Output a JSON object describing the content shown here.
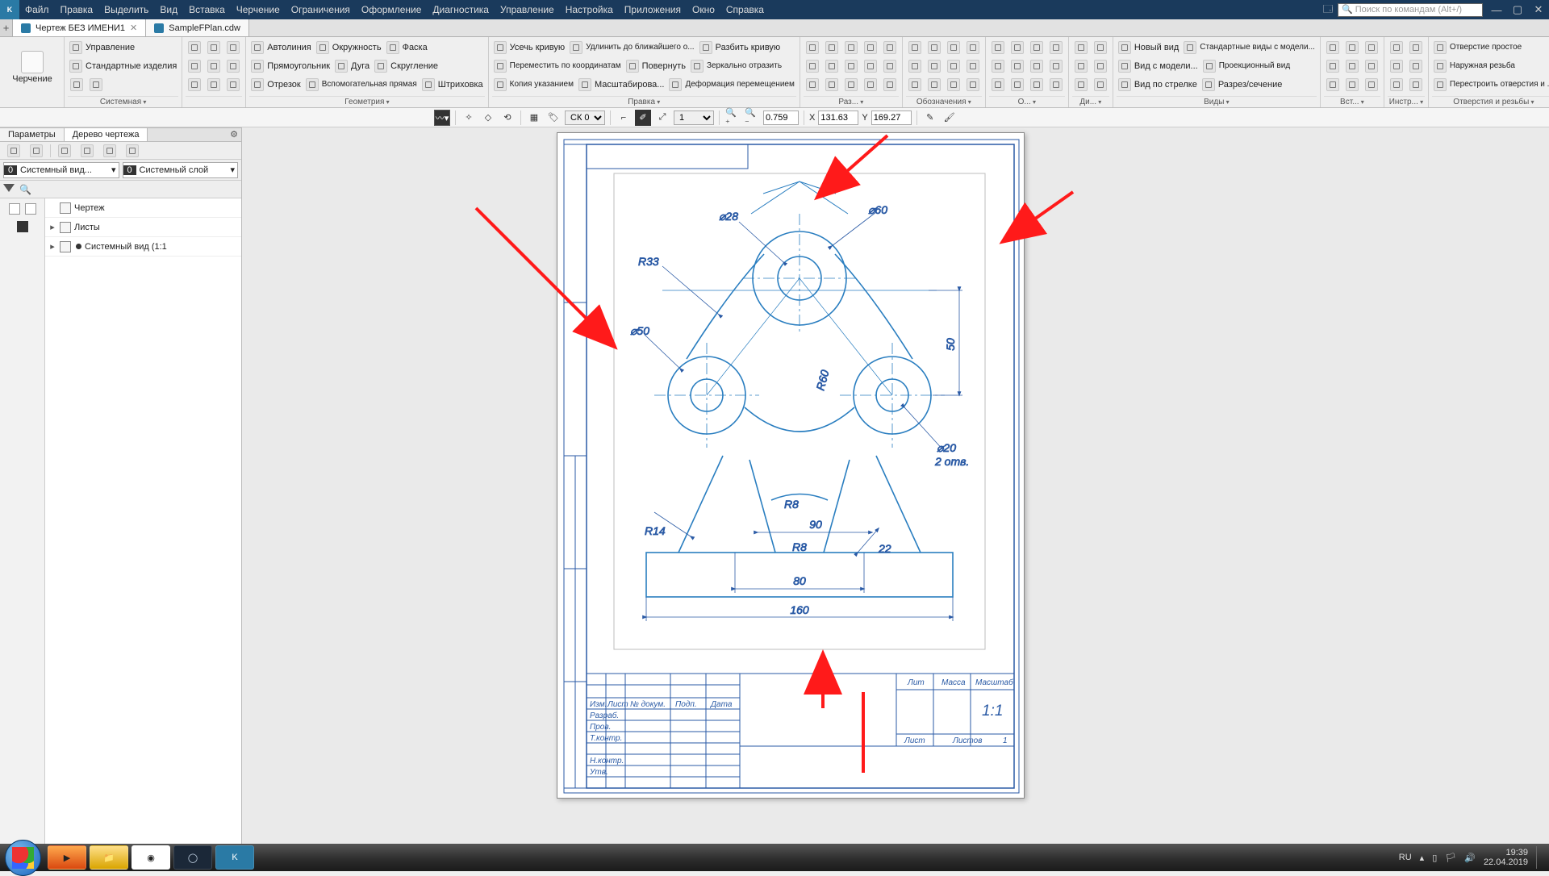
{
  "menu": {
    "items": [
      "Файл",
      "Правка",
      "Выделить",
      "Вид",
      "Вставка",
      "Черчение",
      "Ограничения",
      "Оформление",
      "Диагностика",
      "Управление",
      "Настройка",
      "Приложения",
      "Окно",
      "Справка"
    ]
  },
  "search_placeholder": "Поиск по командам (Alt+/)",
  "tabs": [
    {
      "label": "Чертеж БЕЗ ИМЕНИ1",
      "active": true
    },
    {
      "label": "SampleFPlan.cdw",
      "active": false
    }
  ],
  "ribbon": {
    "big1": "Черчение",
    "big2": "Управление",
    "big3": "Стандартные изделия",
    "group_system": "Системная",
    "geom": {
      "label": "Геометрия",
      "items": [
        "Автолиния",
        "Окружность",
        "Фаска",
        "Прямоугольник",
        "Дуга",
        "Скругление",
        "Отрезок",
        "Вспомогатель­ная прямая",
        "Штриховка"
      ]
    },
    "edit": {
      "label": "Правка",
      "items": [
        "Усечь кривую",
        "Удлинить до ближайшего о...",
        "Разбить кривую",
        "Переместить по координатам",
        "Повернуть",
        "Зеркально отразить",
        "Копия указанием",
        "Масштабирова...",
        "Деформация перемещением"
      ]
    },
    "dims": {
      "label": "Раз..."
    },
    "symbols": {
      "label": "Обозначения"
    },
    "constraints": {
      "label": "О..."
    },
    "diag": {
      "label": "Ди..."
    },
    "views": {
      "label": "Виды",
      "items": [
        "Новый вид",
        "Стандартные виды с модели...",
        "Отверстие простое",
        "Вид с модели...",
        "Проекционный вид",
        "Наружная резьба",
        "Вид по стрелке",
        "Разрез/сечение",
        "Перестроить отверстия и ..."
      ]
    },
    "insert": {
      "label": "Вст..."
    },
    "restr": {
      "label": "Инстр..."
    },
    "holes": {
      "label": "Отверстия и резьбы"
    }
  },
  "minibar": {
    "cs": "СК 0",
    "scale": "1",
    "zoom": "0.759",
    "xlabel": "X",
    "x": "131.63",
    "ylabel": "Y",
    "y": "169.27"
  },
  "panels": {
    "params": "Параметры",
    "tree": "Дерево чертежа"
  },
  "dd": {
    "view": "Системный вид...",
    "layer": "Системный слой"
  },
  "tree": {
    "root": "Чертеж",
    "sheets": "Листы",
    "sysview": "Системный вид (1:1"
  },
  "drawing": {
    "dims": {
      "d28": "⌀28",
      "d60": "⌀60",
      "r33": "R33",
      "d50": "⌀50",
      "r60": "R60",
      "d20": "⌀20",
      "d20note": "2 отв.",
      "r8a": "R8",
      "r8b": "R8",
      "r14": "R14",
      "w90": "90",
      "w22": "22",
      "w80": "80",
      "w160": "160",
      "h50": "50"
    },
    "title": {
      "scale": "1:1",
      "col1": "Лит",
      "col2": "Масса",
      "col3": "Масштаб",
      "row_izm": "Изм.",
      "row_list": "Лист",
      "row_ndoc": "№ докум.",
      "row_podp": "Подп.",
      "row_data": "Дата",
      "r_razrab": "Разраб.",
      "r_prov": "Пров.",
      "r_tkontr": "Т.контр.",
      "r_nkontr": "Н.контр.",
      "r_utv": "Утв.",
      "sheet": "Лист",
      "sheets": "Листов",
      "sheets_n": "1"
    }
  },
  "tray": {
    "lang": "RU",
    "time": "19:39",
    "date": "22.04.2019"
  }
}
